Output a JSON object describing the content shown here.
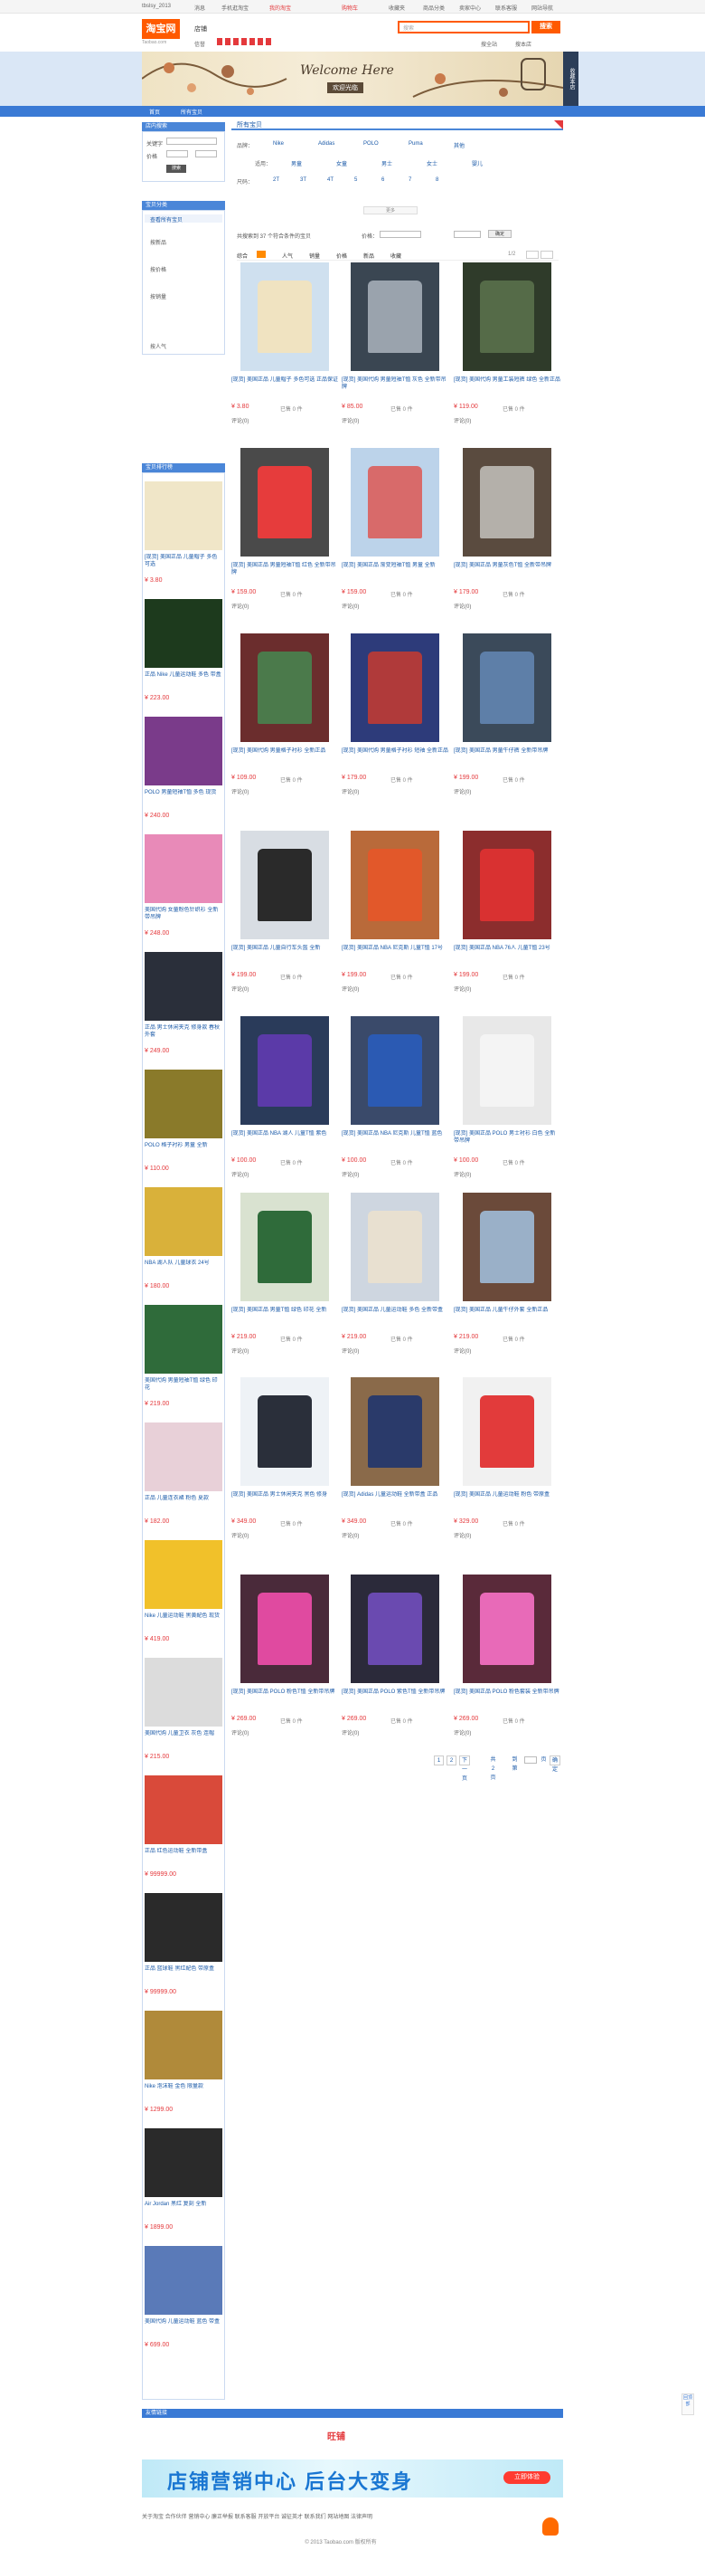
{
  "topbar": {
    "user": "tbslsy_2013",
    "links": [
      "消息",
      "手机逛淘宝",
      "我的淘宝",
      "购物车",
      "收藏夹",
      "商品分类",
      "卖家中心",
      "联系客服",
      "网站导航"
    ]
  },
  "header": {
    "logo": "淘宝网",
    "logo_sub": "Taobao.com",
    "shop_label": "店铺",
    "credit_label": "信誉",
    "search_placeholder": "搜索",
    "search_button": "搜索",
    "right_links": [
      "搜全站",
      "搜本店"
    ]
  },
  "banner": {
    "title": "Welcome Here",
    "subtitle": "欢迎光临",
    "side": "收藏本店"
  },
  "nav": [
    "首页",
    "所有宝贝"
  ],
  "sidebar": {
    "search_title": "店内搜索",
    "keyword_label": "关键字",
    "price_label": "价格",
    "search_button": "搜索",
    "category_title": "宝贝分类",
    "categories": [
      "查看所有宝贝",
      "按新品",
      "按价格",
      "按销量",
      "按人气"
    ],
    "hot_title": "宝贝排行榜",
    "items": [
      {
        "title": "[现货] 美国正品 儿童帽子 多色可选",
        "price": "¥ 3.80"
      },
      {
        "title": "正品 Nike 儿童运动鞋 多色 带盒",
        "price": "¥ 223.00"
      },
      {
        "title": "POLO 男童短袖T恤 多色 现货",
        "price": "¥ 240.00"
      },
      {
        "title": "美国代购 女童粉色针织衫 全新带吊牌",
        "price": "¥ 248.00"
      },
      {
        "title": "正品 男士休闲夹克 修身款 春秋外套",
        "price": "¥ 249.00"
      },
      {
        "title": "POLO 格子衬衫 男童 全新",
        "price": "¥ 110.00"
      },
      {
        "title": "NBA 湖人队 儿童球衣 24号",
        "price": "¥ 180.00"
      },
      {
        "title": "美国代购 男童短袖T恤 绿色 印花",
        "price": "¥ 219.00"
      },
      {
        "title": "正品 儿童连衣裙 粉色 夏款",
        "price": "¥ 182.00"
      },
      {
        "title": "Nike 儿童运动鞋 黑黄配色 现货",
        "price": "¥ 419.00"
      },
      {
        "title": "美国代购 儿童卫衣 灰色 连帽",
        "price": "¥ 215.00"
      },
      {
        "title": "正品 红色运动鞋 全新带盒",
        "price": "¥ 99999.00"
      },
      {
        "title": "正品 篮球鞋 黑红配色 带原盒",
        "price": "¥ 99999.00"
      },
      {
        "title": "Nike 泡沫鞋 金色 限量款",
        "price": "¥ 1299.00"
      },
      {
        "title": "Air Jordan 黑红 复刻 全新",
        "price": "¥ 1899.00"
      },
      {
        "title": "美国代购 儿童运动鞋 蓝色 带盒",
        "price": "¥ 699.00"
      }
    ]
  },
  "main": {
    "title": "所有宝贝",
    "filter_rows": [
      {
        "label": "品牌：",
        "values": [
          "Nike",
          "Adidas",
          "POLO",
          "Puma",
          "其他"
        ]
      },
      {
        "label": "适用：",
        "values": [
          "男童",
          "女童",
          "男士",
          "女士",
          "婴儿"
        ]
      },
      {
        "label": "尺码：",
        "values": [
          "2T",
          "3T",
          "4T",
          "5",
          "6",
          "7",
          "8"
        ]
      }
    ],
    "more_button": "更多",
    "search_row": {
      "text": "共搜索到 37 个符合条件的宝贝",
      "price_label": "价格：",
      "ok": "确定"
    },
    "sort": [
      "综合",
      "人气",
      "销量",
      "价格",
      "新品",
      "收藏"
    ],
    "pagination_info": "1/2",
    "products": [
      {
        "title": "[现货] 美国正品 儿童帽子 多色可选 正品保证",
        "price": "¥ 3.80",
        "sold": "已售 0 件",
        "rev": "评论(0)"
      },
      {
        "title": "[现货] 美国代购 男童短袖T恤 灰色 全新带吊牌",
        "price": "¥ 85.00",
        "sold": "已售 0 件",
        "rev": "评论(0)"
      },
      {
        "title": "[现货] 美国代购 男童工装短裤 绿色 全新正品",
        "price": "¥ 119.00",
        "sold": "已售 0 件",
        "rev": "评论(0)"
      },
      {
        "title": "[现货] 美国正品 男童短袖T恤 红色 全新带吊牌",
        "price": "¥ 159.00",
        "sold": "已售 0 件",
        "rev": "评论(0)"
      },
      {
        "title": "[现货] 美国正品 渐变短袖T恤 男童 全新",
        "price": "¥ 159.00",
        "sold": "已售 0 件",
        "rev": "评论(0)"
      },
      {
        "title": "[现货] 美国正品 男童灰色T恤 全新带吊牌",
        "price": "¥ 179.00",
        "sold": "已售 0 件",
        "rev": "评论(0)"
      },
      {
        "title": "[现货] 美国代购 男童格子衬衫 全新正品",
        "price": "¥ 109.00",
        "sold": "已售 0 件",
        "rev": "评论(0)"
      },
      {
        "title": "[现货] 美国代购 男童格子衬衫 短袖 全新正品",
        "price": "¥ 179.00",
        "sold": "已售 0 件",
        "rev": "评论(0)"
      },
      {
        "title": "[现货] 美国正品 男童牛仔裤 全新带吊牌",
        "price": "¥ 199.00",
        "sold": "已售 0 件",
        "rev": "评论(0)"
      },
      {
        "title": "[现货] 美国正品 儿童自行车头盔 全新",
        "price": "¥ 199.00",
        "sold": "已售 0 件",
        "rev": "评论(0)"
      },
      {
        "title": "[现货] 美国正品 NBA 尼克斯 儿童T恤 17号",
        "price": "¥ 199.00",
        "sold": "已售 0 件",
        "rev": "评论(0)"
      },
      {
        "title": "[现货] 美国正品 NBA 76人 儿童T恤 23号",
        "price": "¥ 199.00",
        "sold": "已售 0 件",
        "rev": "评论(0)"
      },
      {
        "title": "[现货] 美国正品 NBA 湖人 儿童T恤 紫色",
        "price": "¥ 100.00",
        "sold": "已售 0 件",
        "rev": "评论(0)"
      },
      {
        "title": "[现货] 美国正品 NBA 尼克斯 儿童T恤 蓝色",
        "price": "¥ 100.00",
        "sold": "已售 0 件",
        "rev": "评论(0)"
      },
      {
        "title": "[现货] 美国正品 POLO 男士衬衫 白色 全新带吊牌",
        "price": "¥ 100.00",
        "sold": "已售 0 件",
        "rev": "评论(0)"
      },
      {
        "title": "[现货] 美国正品 男童T恤 绿色 印花 全新",
        "price": "¥ 219.00",
        "sold": "已售 0 件",
        "rev": "评论(0)"
      },
      {
        "title": "[现货] 美国正品 儿童运动鞋 多色 全新带盒",
        "price": "¥ 219.00",
        "sold": "已售 0 件",
        "rev": "评论(0)"
      },
      {
        "title": "[现货] 美国正品 儿童牛仔外套 全新正品",
        "price": "¥ 219.00",
        "sold": "已售 0 件",
        "rev": "评论(0)"
      },
      {
        "title": "[现货] 美国正品 男士休闲夹克 黑色 修身",
        "price": "¥ 349.00",
        "sold": "已售 0 件",
        "rev": "评论(0)"
      },
      {
        "title": "[现货] Adidas 儿童运动鞋 全新带盒 正品",
        "price": "¥ 349.00",
        "sold": "已售 0 件",
        "rev": "评论(0)"
      },
      {
        "title": "[现货] 美国正品 儿童运动鞋 粉色 带原盒",
        "price": "¥ 329.00",
        "sold": "已售 0 件",
        "rev": "评论(0)"
      },
      {
        "title": "[现货] 美国正品 POLO 粉色T恤 全新带吊牌",
        "price": "¥ 269.00",
        "sold": "已售 0 件",
        "rev": "评论(0)"
      },
      {
        "title": "[现货] 美国正品 POLO 紫色T恤 全新带吊牌",
        "price": "¥ 269.00",
        "sold": "已售 0 件",
        "rev": "评论(0)"
      },
      {
        "title": "[现货] 美国正品 POLO 粉色套装 全新带吊牌",
        "price": "¥ 269.00",
        "sold": "已售 0 件",
        "rev": "评论(0)"
      }
    ],
    "pager": [
      "1",
      "2",
      "下一页",
      "共2页",
      "到第",
      "页",
      "确定"
    ]
  },
  "footer": {
    "links_bar": "友情链接",
    "logo": "旺铺",
    "promo_text": "店铺营销中心 后台大变身",
    "promo_button": "立即体验",
    "links": "关于淘宝  合作伙伴  营销中心  廉正举报  联系客服  开放平台  诚征英才  联系我们  网站地图  法律声明",
    "copyright": "© 2013 Taobao.com 版权所有"
  },
  "float": "回顶部"
}
